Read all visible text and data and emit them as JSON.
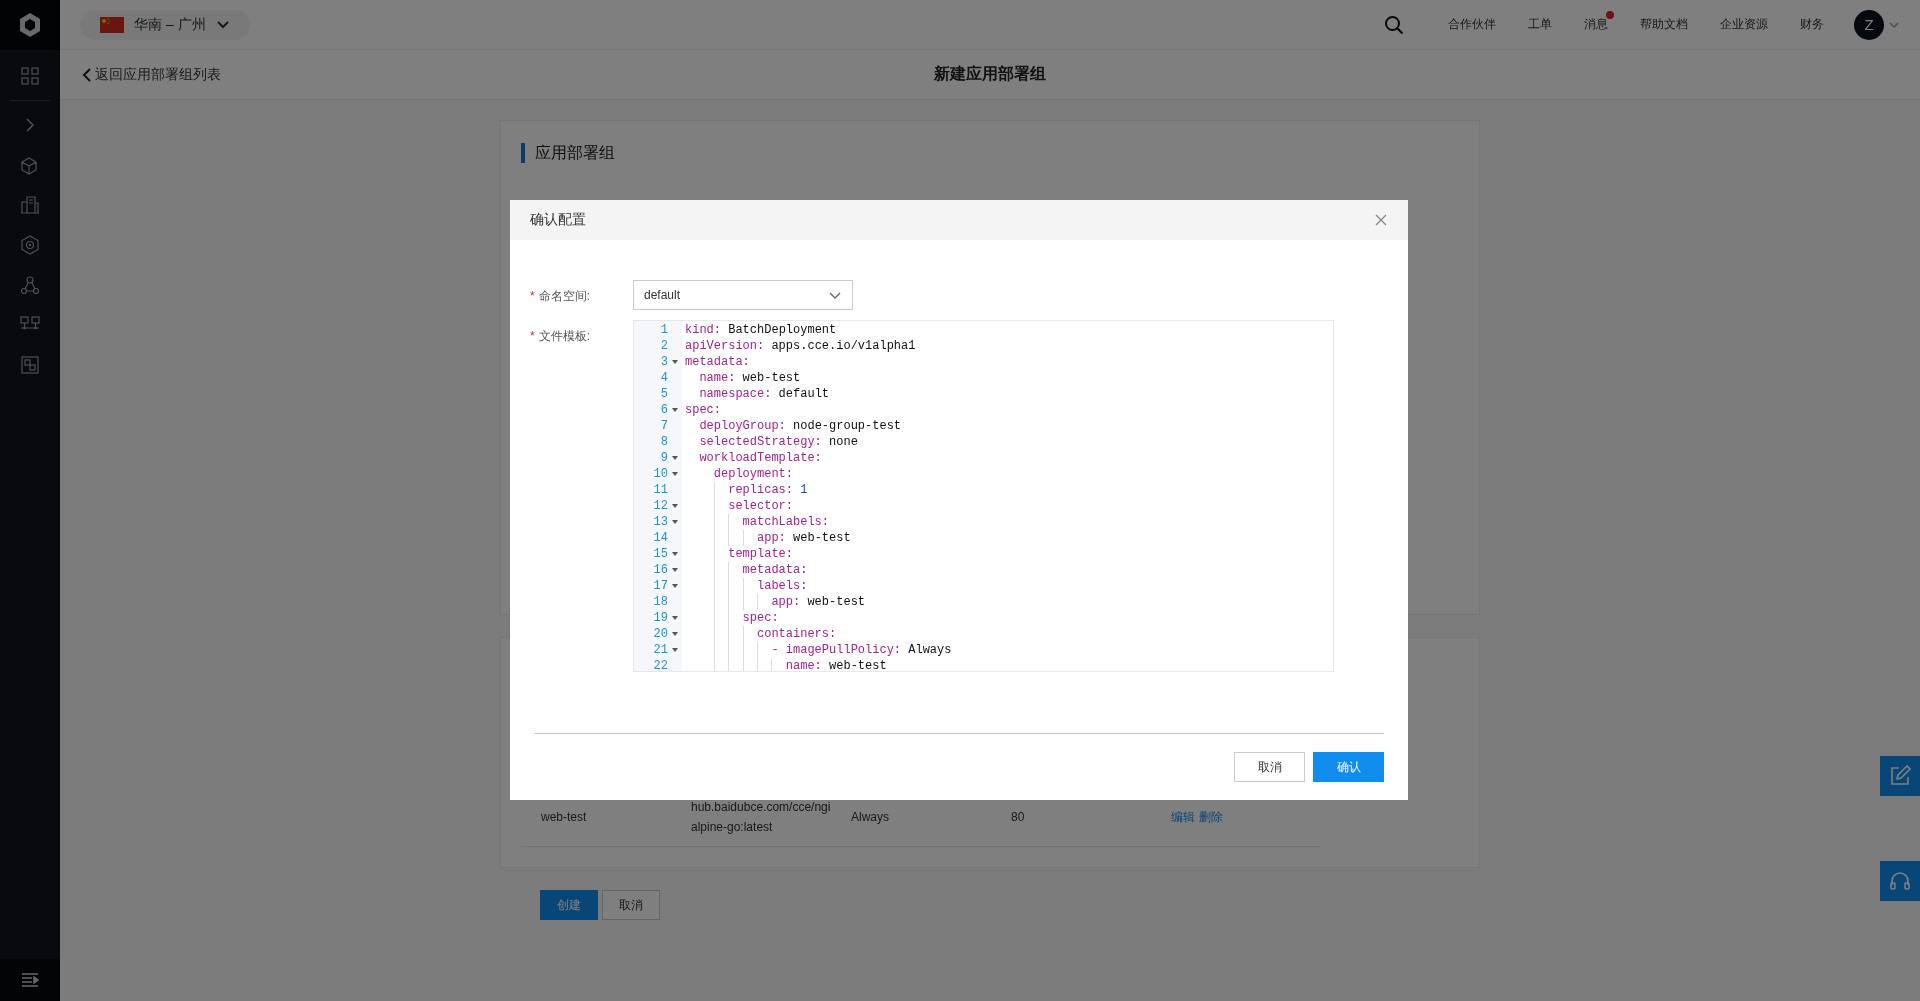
{
  "top_bar": {
    "region": "华南 – 广州",
    "nav": [
      {
        "label": "合作伙伴",
        "badge": false
      },
      {
        "label": "工单",
        "badge": false
      },
      {
        "label": "消息",
        "badge": true
      },
      {
        "label": "帮助文档",
        "badge": false
      },
      {
        "label": "企业资源",
        "badge": false
      },
      {
        "label": "财务",
        "badge": false
      }
    ],
    "avatar": "Z"
  },
  "header": {
    "back_link": "返回应用部署组列表",
    "title": "新建应用部署组"
  },
  "section": {
    "title": "应用部署组"
  },
  "table_row": {
    "name": "web-test",
    "image": [
      "hub.baidubce.com/cce/ngi",
      "alpine-go:latest"
    ],
    "policy": "Always",
    "port": "80",
    "actions": [
      "编辑",
      "删除"
    ]
  },
  "form_buttons": [
    {
      "label": "创建",
      "primary": true
    },
    {
      "label": "取消",
      "primary": false
    }
  ],
  "dialog": {
    "title": "确认配置",
    "fields": [
      {
        "kind": "select",
        "required_mark": "*",
        "label": "命名空间:",
        "value": "default"
      },
      {
        "kind": "code",
        "required_mark": "*",
        "label": "文件模板:",
        "lines": [
          {
            "number": "1",
            "fold": false,
            "tokens": [
              {
                "kind": "key",
                "text": "kind:"
              },
              {
                "kind": "plain",
                "text": " BatchDeployment"
              }
            ]
          },
          {
            "number": "2",
            "fold": false,
            "tokens": [
              {
                "kind": "key",
                "text": "apiVersion:"
              },
              {
                "kind": "plain",
                "text": " apps.cce.io/v1alpha1"
              }
            ]
          },
          {
            "number": "3",
            "fold": true,
            "tokens": [
              {
                "kind": "key",
                "text": "metadata:"
              }
            ]
          },
          {
            "number": "4",
            "fold": false,
            "tokens": [
              {
                "kind": "key",
                "text": "  name:"
              },
              {
                "kind": "plain",
                "text": " web-test"
              }
            ]
          },
          {
            "number": "5",
            "fold": false,
            "tokens": [
              {
                "kind": "key",
                "text": "  namespace:"
              },
              {
                "kind": "plain",
                "text": " default"
              }
            ]
          },
          {
            "number": "6",
            "fold": true,
            "tokens": [
              {
                "kind": "key",
                "text": "spec:"
              }
            ]
          },
          {
            "number": "7",
            "fold": false,
            "tokens": [
              {
                "kind": "key",
                "text": "  deployGroup:"
              },
              {
                "kind": "plain",
                "text": " node-group-test"
              }
            ]
          },
          {
            "number": "8",
            "fold": false,
            "tokens": [
              {
                "kind": "key",
                "text": "  selectedStrategy:"
              },
              {
                "kind": "plain",
                "text": " none"
              }
            ]
          },
          {
            "number": "9",
            "fold": true,
            "tokens": [
              {
                "kind": "key",
                "text": "  workloadTemplate:"
              }
            ]
          },
          {
            "number": "10",
            "fold": true,
            "tokens": [
              {
                "kind": "key",
                "text": "    deployment:"
              }
            ]
          },
          {
            "number": "11",
            "fold": false,
            "tokens": [
              {
                "kind": "key",
                "text": "      replicas:"
              },
              {
                "kind": "number",
                "text": " 1"
              }
            ]
          },
          {
            "number": "12",
            "fold": true,
            "tokens": [
              {
                "kind": "key",
                "text": "      selector:"
              }
            ]
          },
          {
            "number": "13",
            "fold": true,
            "tokens": [
              {
                "kind": "key",
                "text": "        matchLabels:"
              }
            ]
          },
          {
            "number": "14",
            "fold": false,
            "tokens": [
              {
                "kind": "key",
                "text": "          app:"
              },
              {
                "kind": "plain",
                "text": " web-test"
              }
            ]
          },
          {
            "number": "15",
            "fold": true,
            "tokens": [
              {
                "kind": "key",
                "text": "      template:"
              }
            ]
          },
          {
            "number": "16",
            "fold": true,
            "tokens": [
              {
                "kind": "key",
                "text": "        metadata:"
              }
            ]
          },
          {
            "number": "17",
            "fold": true,
            "tokens": [
              {
                "kind": "key",
                "text": "          labels:"
              }
            ]
          },
          {
            "number": "18",
            "fold": false,
            "tokens": [
              {
                "kind": "key",
                "text": "            app:"
              },
              {
                "kind": "plain",
                "text": " web-test"
              }
            ]
          },
          {
            "number": "19",
            "fold": true,
            "tokens": [
              {
                "kind": "key",
                "text": "        spec:"
              }
            ]
          },
          {
            "number": "20",
            "fold": true,
            "tokens": [
              {
                "kind": "key",
                "text": "          containers:"
              }
            ]
          },
          {
            "number": "21",
            "fold": true,
            "tokens": [
              {
                "kind": "key",
                "text": "            - imagePullPolicy:"
              },
              {
                "kind": "plain",
                "text": " Always"
              }
            ]
          },
          {
            "number": "22",
            "fold": false,
            "tokens": [
              {
                "kind": "key",
                "text": "              name:"
              },
              {
                "kind": "plain",
                "text": " web-test"
              }
            ]
          }
        ]
      }
    ],
    "buttons": [
      {
        "label": "取消",
        "primary": false
      },
      {
        "label": "确认",
        "primary": true
      }
    ]
  }
}
